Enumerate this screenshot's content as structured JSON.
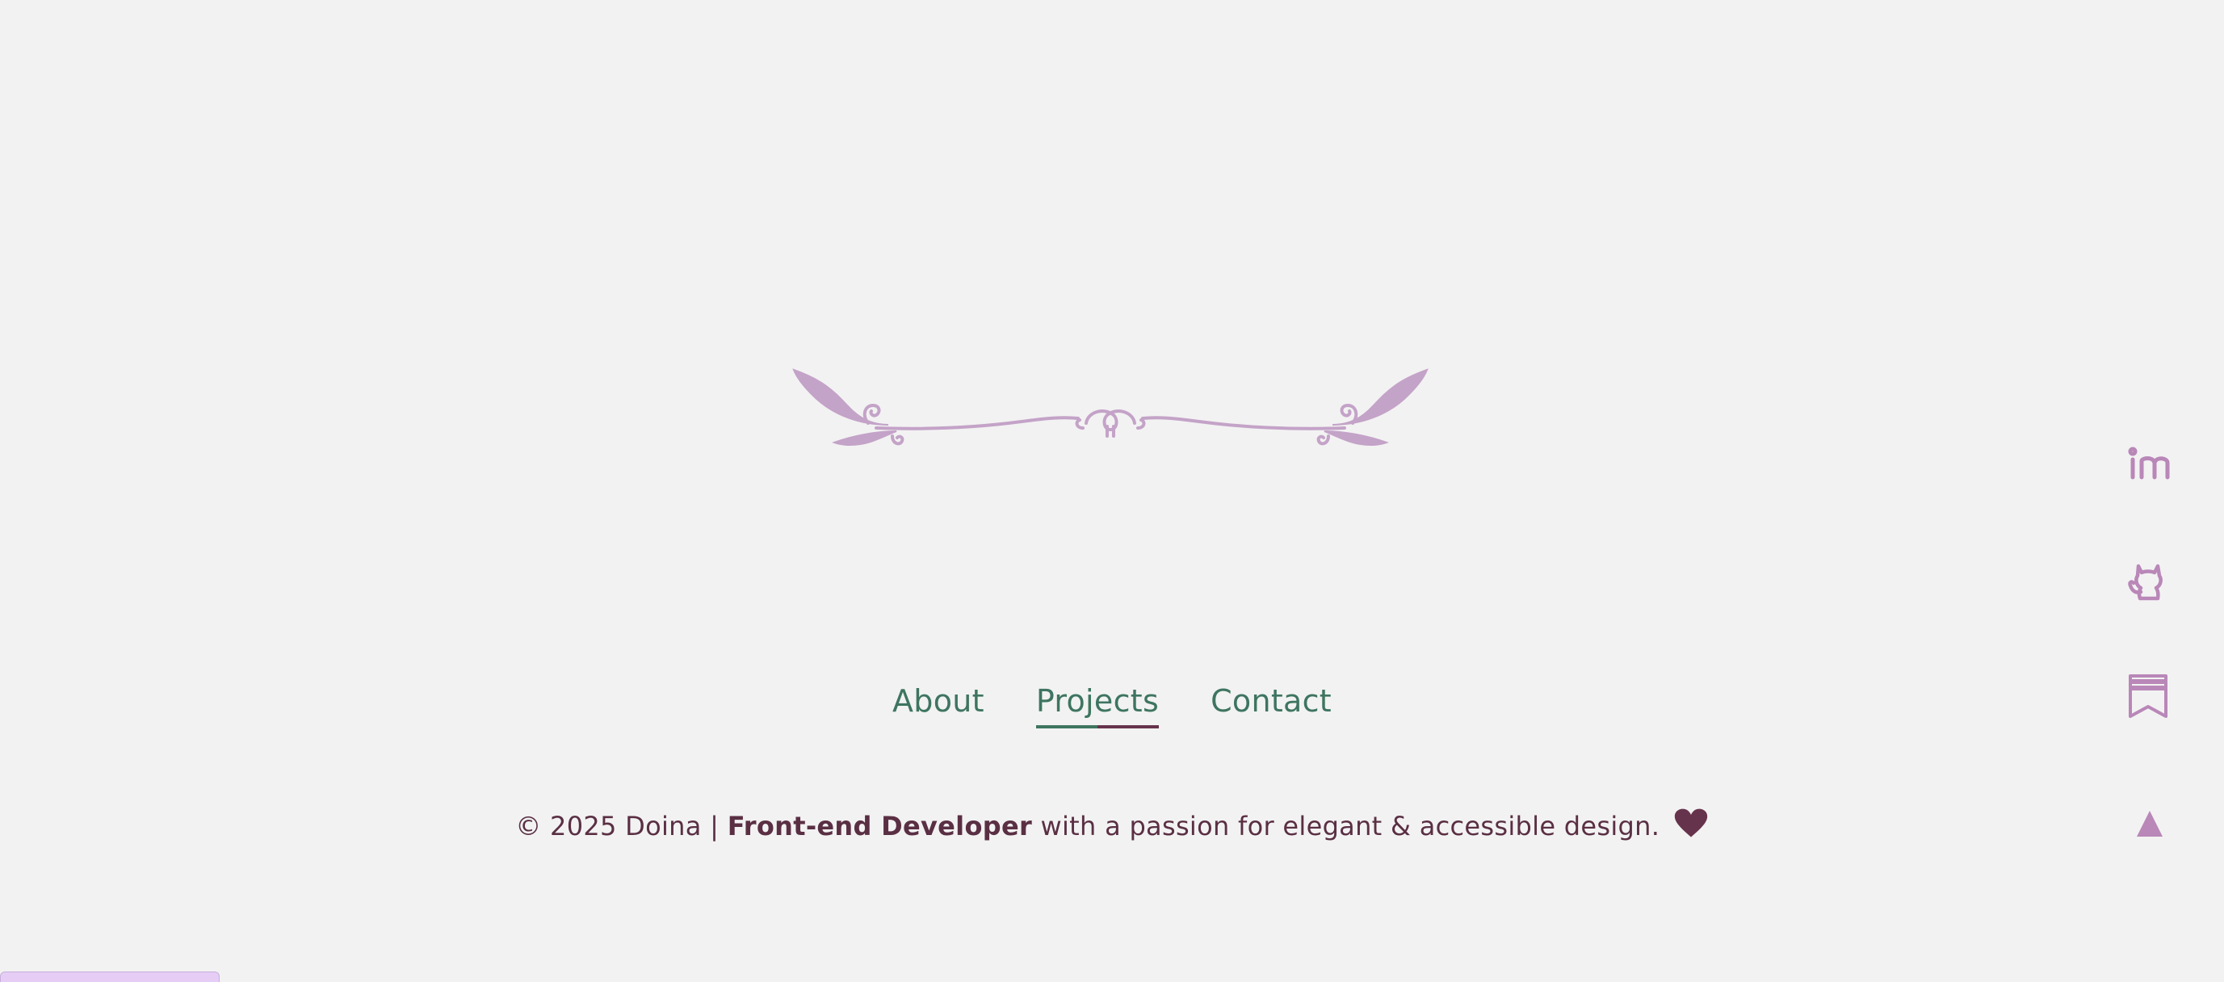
{
  "nav": {
    "items": [
      {
        "label": "About"
      },
      {
        "label": "Projects",
        "active": true
      },
      {
        "label": "Contact"
      }
    ]
  },
  "footer": {
    "copyright_prefix": "© 2025 Doina | ",
    "role": "Front-end Developer",
    "tagline": " with a passion for elegant & accessible design."
  },
  "social": {
    "icons": [
      "linkedin-icon",
      "github-icon",
      "bookmark-icon"
    ],
    "to_top_icon": "arrow-up-icon"
  },
  "colors": {
    "background": "#f2f2f2",
    "ornament": "#c4a3c8",
    "nav_text": "#3e7560",
    "footer_text": "#5a2f43",
    "heart": "#66334c",
    "icon": "#b987b8"
  }
}
